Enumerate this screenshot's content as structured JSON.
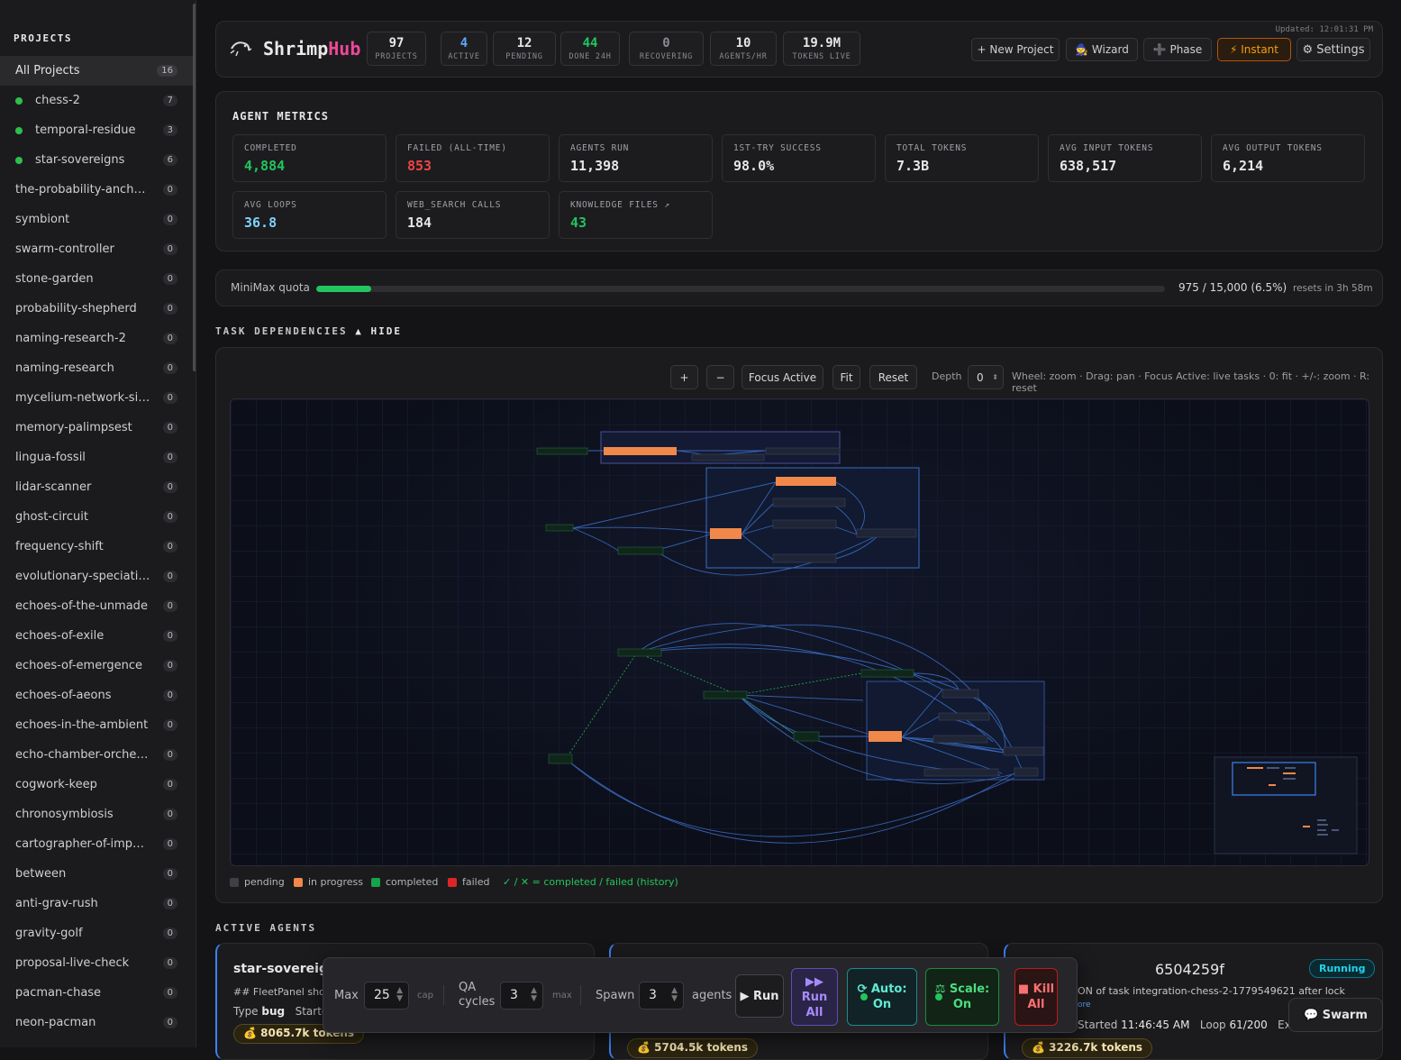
{
  "sidebar": {
    "heading": "PROJECTS",
    "items": [
      {
        "name": "All Projects",
        "count": "16",
        "active": false,
        "selected": true
      },
      {
        "name": "chess-2",
        "count": "7",
        "active": true
      },
      {
        "name": "temporal-residue",
        "count": "3",
        "active": true
      },
      {
        "name": "star-sovereigns",
        "count": "6",
        "active": true
      },
      {
        "name": "the-probability-anchors",
        "count": "0"
      },
      {
        "name": "symbiont",
        "count": "0"
      },
      {
        "name": "swarm-controller",
        "count": "0"
      },
      {
        "name": "stone-garden",
        "count": "0"
      },
      {
        "name": "probability-shepherd",
        "count": "0"
      },
      {
        "name": "naming-research-2",
        "count": "0"
      },
      {
        "name": "naming-research",
        "count": "0"
      },
      {
        "name": "mycelium-network-sim...",
        "count": "0"
      },
      {
        "name": "memory-palimpsest",
        "count": "0"
      },
      {
        "name": "lingua-fossil",
        "count": "0"
      },
      {
        "name": "lidar-scanner",
        "count": "0"
      },
      {
        "name": "ghost-circuit",
        "count": "0"
      },
      {
        "name": "frequency-shift",
        "count": "0"
      },
      {
        "name": "evolutionary-speciation...",
        "count": "0"
      },
      {
        "name": "echoes-of-the-unmade",
        "count": "0"
      },
      {
        "name": "echoes-of-exile",
        "count": "0"
      },
      {
        "name": "echoes-of-emergence",
        "count": "0"
      },
      {
        "name": "echoes-of-aeons",
        "count": "0"
      },
      {
        "name": "echoes-in-the-ambient",
        "count": "0"
      },
      {
        "name": "echo-chamber-orchestra",
        "count": "0"
      },
      {
        "name": "cogwork-keep",
        "count": "0"
      },
      {
        "name": "chronosymbiosis",
        "count": "0"
      },
      {
        "name": "cartographer-of-imposs...",
        "count": "0"
      },
      {
        "name": "between",
        "count": "0"
      },
      {
        "name": "anti-grav-rush",
        "count": "0"
      },
      {
        "name": "gravity-golf",
        "count": "0"
      },
      {
        "name": "proposal-live-check",
        "count": "0"
      },
      {
        "name": "pacman-chase",
        "count": "0"
      },
      {
        "name": "neon-pacman",
        "count": "0"
      }
    ]
  },
  "header": {
    "logo_a": "Shrimp",
    "logo_b": "Hub",
    "updated": "Updated: 12:01:31 PM",
    "stats": [
      {
        "value": "97",
        "label": "PROJECTS",
        "color": "#e6e6e6"
      },
      {
        "value": "4",
        "label": "ACTIVE",
        "color": "#60a5fa"
      },
      {
        "value": "12",
        "label": "PENDING",
        "color": "#e6e6e6"
      },
      {
        "value": "44",
        "label": "DONE 24H",
        "color": "#22c55e"
      },
      {
        "value": "0",
        "label": "RECOVERING",
        "color": "#8a8a90"
      },
      {
        "value": "10",
        "label": "AGENTS/HR",
        "color": "#e6e6e6"
      },
      {
        "value": "19.9M",
        "label": "TOKENS LIVE",
        "color": "#e6e6e6"
      }
    ],
    "buttons": {
      "new_project": "+ New Project",
      "wizard": "🧙 Wizard",
      "phase": "➕ Phase",
      "instant": "⚡ Instant",
      "settings": "⚙ Settings"
    }
  },
  "metrics": {
    "title": "AGENT METRICS",
    "items": [
      {
        "label": "COMPLETED",
        "value": "4,884",
        "color": "#22c55e"
      },
      {
        "label": "FAILED (ALL-TIME)",
        "value": "853",
        "color": "#ef4444"
      },
      {
        "label": "AGENTS RUN",
        "value": "11,398",
        "color": "#e6e6e6"
      },
      {
        "label": "1ST-TRY SUCCESS",
        "value": "98.0%",
        "color": "#e6e6e6"
      },
      {
        "label": "TOTAL TOKENS",
        "value": "7.3B",
        "color": "#e6e6e6"
      },
      {
        "label": "AVG INPUT TOKENS",
        "value": "638,517",
        "color": "#e6e6e6"
      },
      {
        "label": "AVG OUTPUT TOKENS",
        "value": "6,214",
        "color": "#e6e6e6"
      },
      {
        "label": "AVG LOOPS",
        "value": "36.8",
        "color": "#7dd3fc"
      },
      {
        "label": "WEB_SEARCH CALLS",
        "value": "184",
        "color": "#e6e6e6"
      },
      {
        "label": "KNOWLEDGE FILES ↗",
        "value": "43",
        "color": "#22c55e"
      }
    ]
  },
  "quota": {
    "label": "MiniMax quota",
    "value": "975 / 15,000 (6.5%)",
    "fraction": 0.065,
    "resets": "resets in 3h 58m"
  },
  "deps": {
    "section": "TASK DEPENDENCIES",
    "toggle": "▲ HIDE",
    "zoom_in": "+",
    "zoom_out": "−",
    "focus": "Focus Active",
    "fit": "Fit",
    "reset": "Reset",
    "depth_label": "Depth",
    "depth_value": "0",
    "help": "Wheel: zoom · Drag: pan · Focus Active: live tasks · 0: fit · +/-: zoom · R: reset",
    "legend": {
      "pending": "pending",
      "in_progress": "in progress",
      "completed": "completed",
      "failed": "failed",
      "history": "✓ / ✕ = completed / failed (history)"
    },
    "colors": {
      "pending": "#3f3f46",
      "in_progress": "#f0884a",
      "completed": "#16a34a",
      "failed": "#dc2626"
    }
  },
  "agents": {
    "section": "ACTIVE AGENTS",
    "cards": [
      {
        "title": "star-sovereigns",
        "line1": "## FleetPanel show",
        "type_label": "Type",
        "type": "bug",
        "started": "Startec",
        "tokens": "💰 8065.7k tokens"
      },
      {
        "title": "",
        "tokens": "💰 5704.5k tokens"
      },
      {
        "title": "6504259f",
        "status": "Running",
        "line1": "ON of task integration-chess-2-1779549621 after lock",
        "more": "ore",
        "started_label": "Started",
        "started": "11:46:45 AM",
        "loop_label": "Loop",
        "loop": "61/200",
        "exit": "Exit",
        "tokens": "💰 3226.7k tokens"
      }
    ]
  },
  "controls": {
    "max_label": "Max",
    "max_value": "25",
    "cap": "cap",
    "qa_label": "QA cycles",
    "qa_value": "3",
    "qa_max": "max",
    "spawn_label": "Spawn",
    "spawn_value": "3",
    "agents_label": "agents",
    "run": "▶ Run",
    "run_all": "▶▶ Run All",
    "auto": "⟳ Auto: On",
    "scale": "⚖ Scale: On",
    "kill": "■ Kill All"
  },
  "swarm": "💬 Swarm"
}
